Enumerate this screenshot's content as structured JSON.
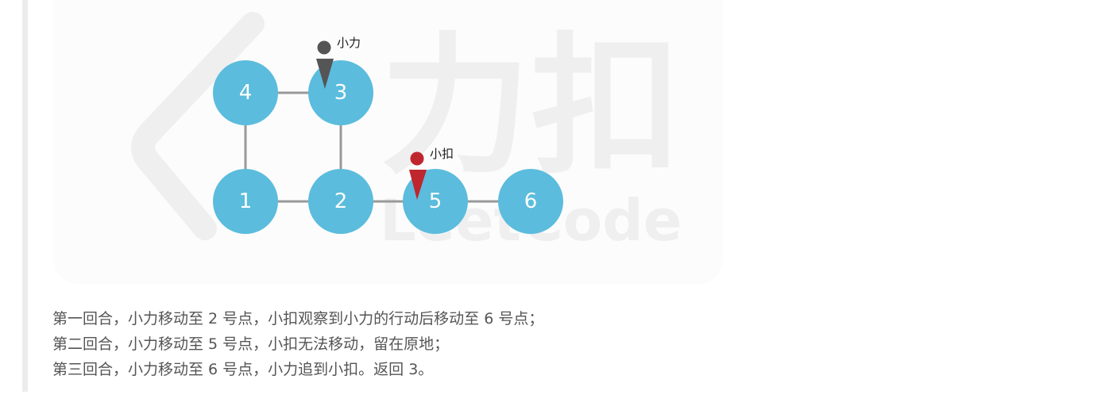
{
  "figure": {
    "nodes": [
      {
        "id": "1",
        "label": "1"
      },
      {
        "id": "2",
        "label": "2"
      },
      {
        "id": "3",
        "label": "3"
      },
      {
        "id": "4",
        "label": "4"
      },
      {
        "id": "5",
        "label": "5"
      },
      {
        "id": "6",
        "label": "6"
      }
    ],
    "edges": [
      [
        "4",
        "3"
      ],
      [
        "4",
        "1"
      ],
      [
        "3",
        "2"
      ],
      [
        "1",
        "2"
      ],
      [
        "2",
        "5"
      ],
      [
        "5",
        "6"
      ]
    ],
    "players": [
      {
        "name": "小力",
        "at_node": "3",
        "color": "#555555"
      },
      {
        "name": "小扣",
        "at_node": "5",
        "color": "#c0262d"
      }
    ],
    "node_color": "#5bbcdd",
    "edge_color": "#999999",
    "watermark": {
      "brand": "力扣",
      "latin": "LeetCode"
    }
  },
  "explanation": {
    "lines": [
      "第一回合，小力移动至 2 号点，小扣观察到小力的行动后移动至 6 号点；",
      "第二回合，小力移动至 5 号点，小扣无法移动，留在原地；",
      "第三回合，小力移动至 6 号点，小力追到小扣。返回 3。"
    ]
  }
}
